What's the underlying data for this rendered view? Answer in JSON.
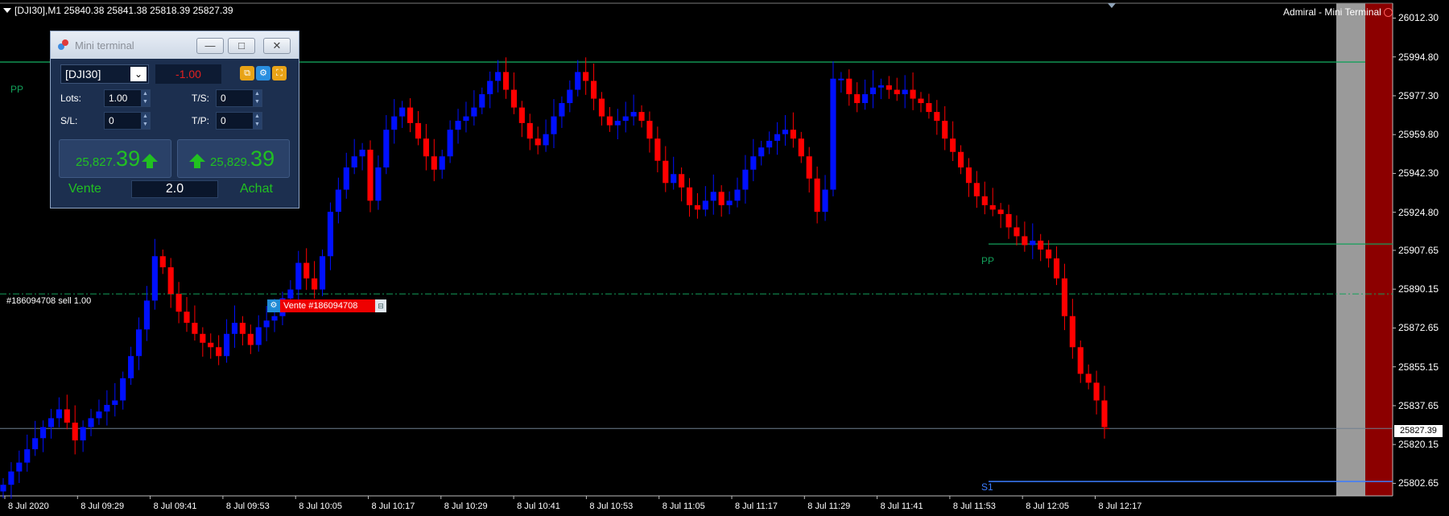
{
  "header": {
    "symbol_info": "[DJI30],M1  25840.38 25841.38 25818.39 25827.39",
    "brand": "Admiral - Mini Terminal"
  },
  "colors": {
    "bull": "#0010ff",
    "bear": "#ff0000",
    "pivot": "#13a05a",
    "support": "#3c7cff",
    "background": "#000000"
  },
  "mini_terminal": {
    "title": "Mini terminal",
    "symbol": "[DJI30]",
    "change": "-1.00",
    "lots_label": "Lots:",
    "lots_value": "1.00",
    "ts_label": "T/S:",
    "ts_value": "0",
    "sl_label": "S/L:",
    "sl_value": "0",
    "tp_label": "T/P:",
    "tp_value": "0",
    "sell_price_main": "25,827.",
    "sell_price_big": "39",
    "buy_price_main": "25,829.",
    "buy_price_big": "39",
    "sell_label": "Vente",
    "buy_label": "Achat",
    "volume": "2.0"
  },
  "order": {
    "left_label": "#186094708 sell 1.00",
    "tag_label": "Vente #186094708"
  },
  "levels": {
    "pp_label": "PP",
    "s1_label": "S1",
    "current_price": "25827.39"
  },
  "chart_data": {
    "type": "candlestick",
    "symbol": "[DJI30]",
    "timeframe": "M1",
    "y_ticks": [
      "26012.30",
      "25994.80",
      "25977.30",
      "25959.80",
      "25942.30",
      "25924.80",
      "25907.65",
      "25890.15",
      "25872.65",
      "25855.15",
      "25837.65",
      "25820.15",
      "25802.65"
    ],
    "x_ticks": [
      "8 Jul 2020",
      "8 Jul 09:29",
      "8 Jul 09:41",
      "8 Jul 09:53",
      "8 Jul 10:05",
      "8 Jul 10:17",
      "8 Jul 10:29",
      "8 Jul 10:41",
      "8 Jul 10:53",
      "8 Jul 11:05",
      "8 Jul 11:17",
      "8 Jul 11:29",
      "8 Jul 11:41",
      "8 Jul 11:53",
      "8 Jul 12:05",
      "8 Jul 12:17"
    ],
    "ylim": [
      25797,
      26019
    ],
    "levels": {
      "pp_left": 25992.5,
      "pp_right": 25910.5,
      "order_sell": 25888.0,
      "current_bid": 25827.39,
      "s1": 25803.5
    },
    "ohlc": {
      "open": 25840.38,
      "high": 25841.38,
      "low": 25818.39,
      "close": 25827.39
    },
    "closes": [
      25802,
      25808,
      25812,
      25818,
      25823,
      25828,
      25832,
      25836,
      25830,
      25822,
      25828,
      25832,
      25835,
      25838,
      25840,
      25850,
      25860,
      25872,
      25885,
      25905,
      25900,
      25888,
      25880,
      25875,
      25870,
      25866,
      25864,
      25860,
      25870,
      25875,
      25870,
      25865,
      25873,
      25876,
      25878,
      25886,
      25890,
      25902,
      25895,
      25890,
      25905,
      25925,
      25935,
      25945,
      25950,
      25953,
      25930,
      25945,
      25962,
      25968,
      25972,
      25965,
      25958,
      25950,
      25944,
      25950,
      25962,
      25966,
      25968,
      25972,
      25978,
      25984,
      25988,
      25980,
      25972,
      25965,
      25958,
      25955,
      25960,
      25968,
      25974,
      25980,
      25988,
      25984,
      25976,
      25968,
      25964,
      25966,
      25968,
      25970,
      25966,
      25958,
      25948,
      25938,
      25942,
      25936,
      25928,
      25926,
      25930,
      25934,
      25928,
      25930,
      25935,
      25944,
      25950,
      25954,
      25957,
      25960,
      25962,
      25958,
      25950,
      25940,
      25925,
      25935,
      25985,
      25985,
      25978,
      25974,
      25978,
      25981,
      25982,
      25980,
      25978,
      25980,
      25976,
      25974,
      25970,
      25966,
      25958,
      25952,
      25945,
      25938,
      25932,
      25928,
      25926,
      25924,
      25918,
      25914,
      25910,
      25912,
      25908,
      25904,
      25895,
      25878,
      25864,
      25852,
      25848,
      25840,
      25828
    ]
  }
}
